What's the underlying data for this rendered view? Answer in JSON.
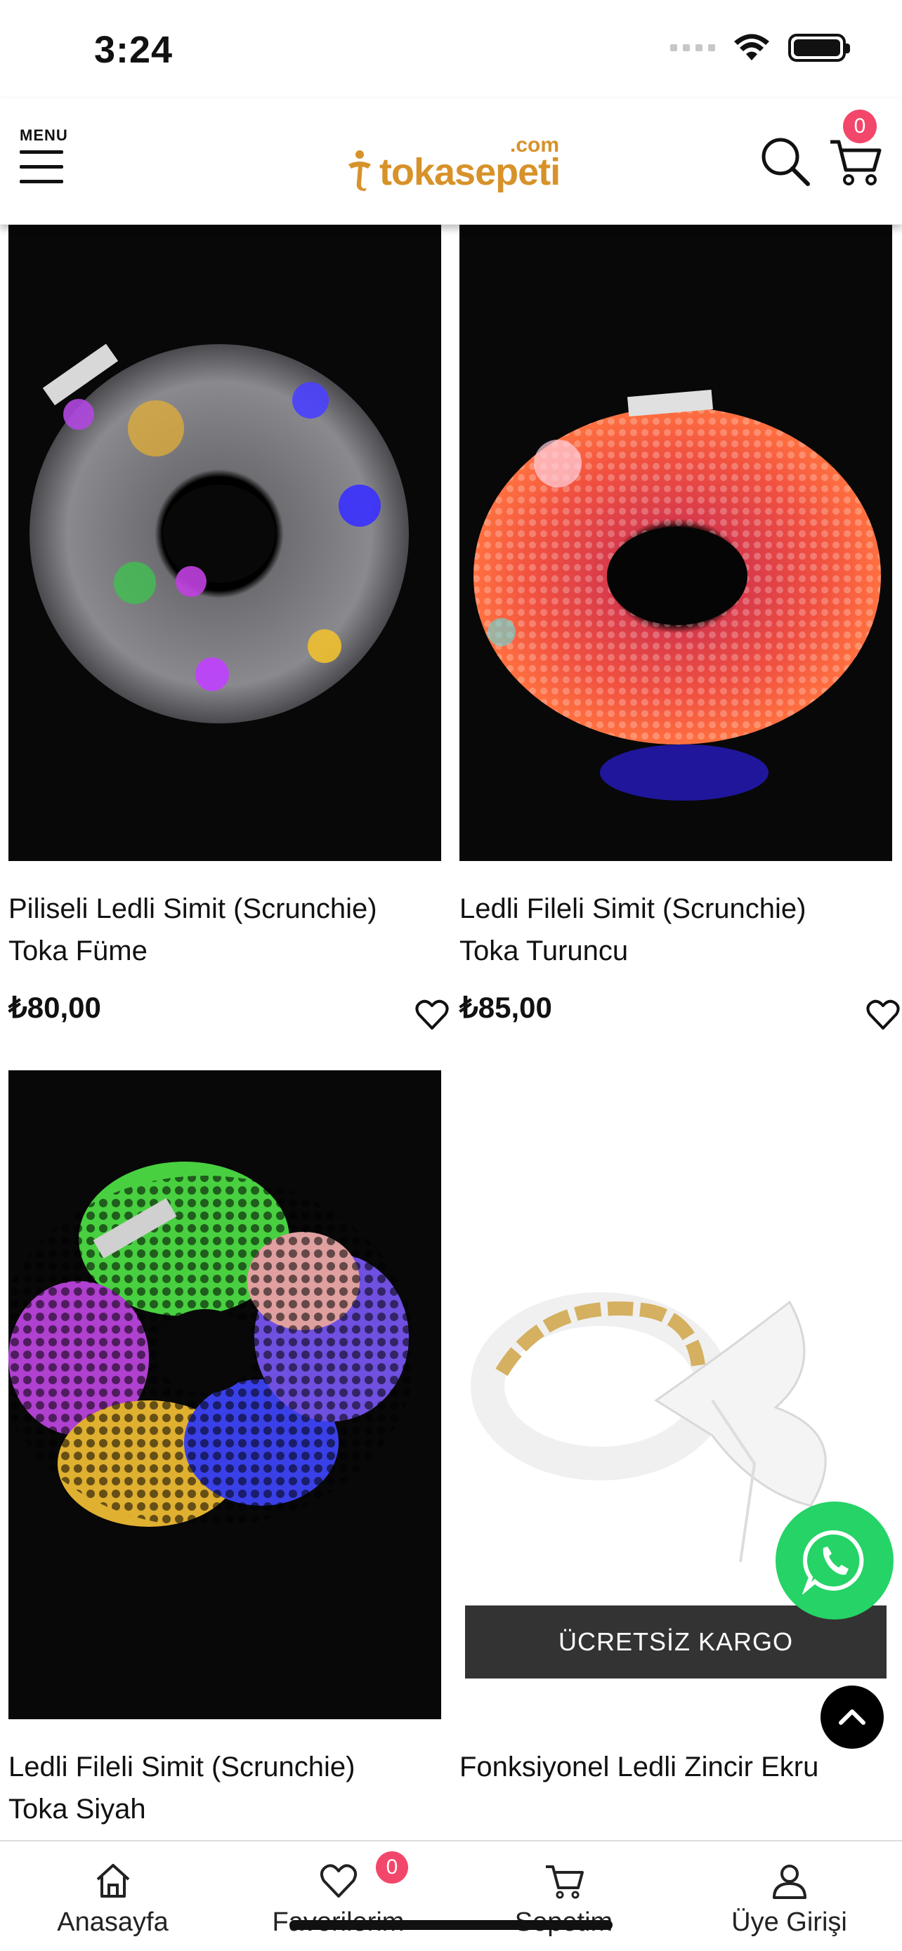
{
  "status_bar": {
    "time": "3:24"
  },
  "header": {
    "menu_label": "MENU",
    "logo_text": "tokasepeti",
    "logo_suffix": ".com",
    "cart_count": "0"
  },
  "products": [
    {
      "title_line1": "Piliseli Ledli Simit (Scrunchie)",
      "title_line2": "Toka Füme",
      "price": "₺80,00"
    },
    {
      "title_line1": "Ledli Fileli Simit (Scrunchie)",
      "title_line2": "Toka Turuncu",
      "price": "₺85,00"
    },
    {
      "title_line1": "Ledli Fileli Simit (Scrunchie)",
      "title_line2": "Toka Siyah"
    },
    {
      "title_line1": "Fonksiyonel Ledli Zincir Ekru",
      "badge": "ÜCRETSİZ KARGO"
    }
  ],
  "bottom_nav": {
    "items": [
      {
        "label": "Anasayfa",
        "icon": "home-icon"
      },
      {
        "label": "Favorilerim",
        "icon": "heart-icon",
        "badge": "0"
      },
      {
        "label": "Sepetim",
        "icon": "cart-icon"
      },
      {
        "label": "Üye Girişi",
        "icon": "user-icon"
      }
    ]
  },
  "colors": {
    "brand": "#d7922a",
    "badge": "#f2476a",
    "whatsapp": "#25d366",
    "free_shipping_bg": "#333333"
  }
}
